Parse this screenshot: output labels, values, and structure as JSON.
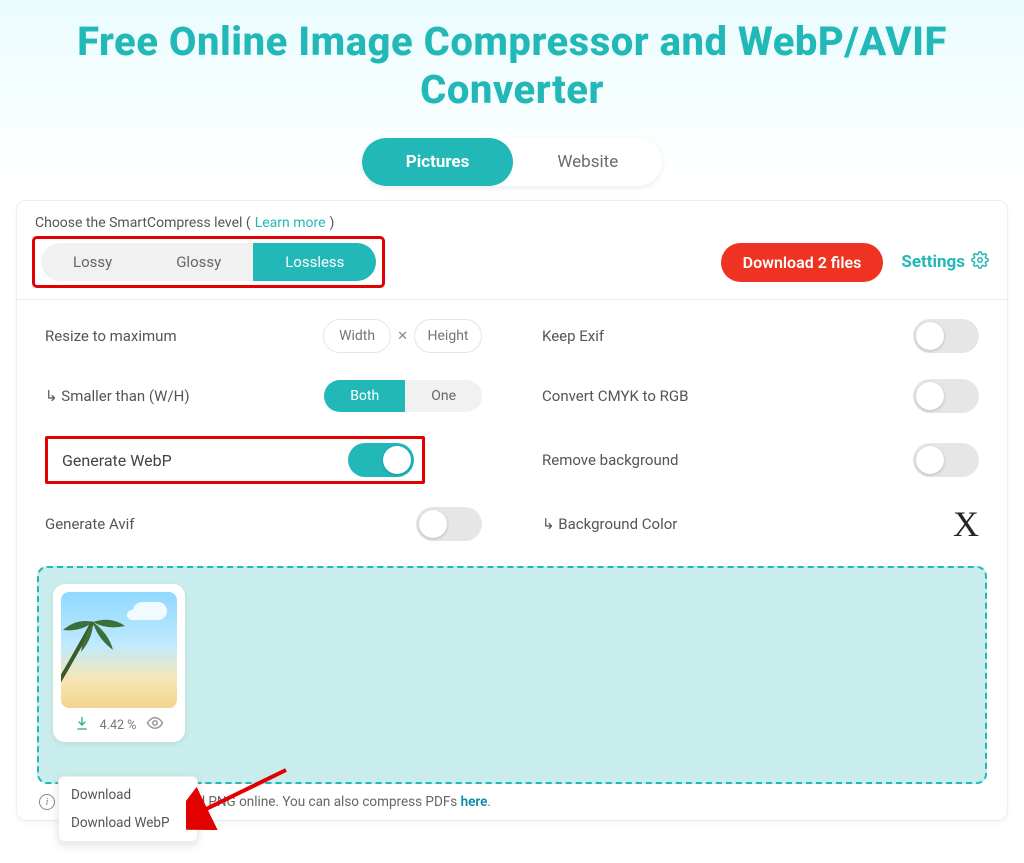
{
  "title": "Free Online Image Compressor and WebP/AVIF Converter",
  "modes": {
    "pictures": "Pictures",
    "website": "Website"
  },
  "level": {
    "prompt": "Choose the SmartCompress level (",
    "learn_more": "Learn more",
    "prompt_end": ")",
    "options": {
      "lossy": "Lossy",
      "glossy": "Glossy",
      "lossless": "Lossless"
    }
  },
  "actions": {
    "download_files": "Download 2 files",
    "settings": "Settings"
  },
  "settings": {
    "resize_label": "Resize to maximum",
    "width_ph": "Width",
    "height_ph": "Height",
    "smaller_label": "↳ Smaller than (W/H)",
    "smaller_both": "Both",
    "smaller_one": "One",
    "gen_webp": "Generate WebP",
    "gen_avif": "Generate Avif",
    "keep_exif": "Keep Exif",
    "convert_cmyk": "Convert CMYK to RGB",
    "remove_bg": "Remove background",
    "bg_color": "↳ Background Color"
  },
  "thumb": {
    "percent": "4.42 %"
  },
  "menu": {
    "download": "Download",
    "download_webp": "Download WebP"
  },
  "footer": {
    "text": "Compress JPG, GIF and PNG online. You can also compress PDFs ",
    "link": "here",
    "dot": "."
  }
}
